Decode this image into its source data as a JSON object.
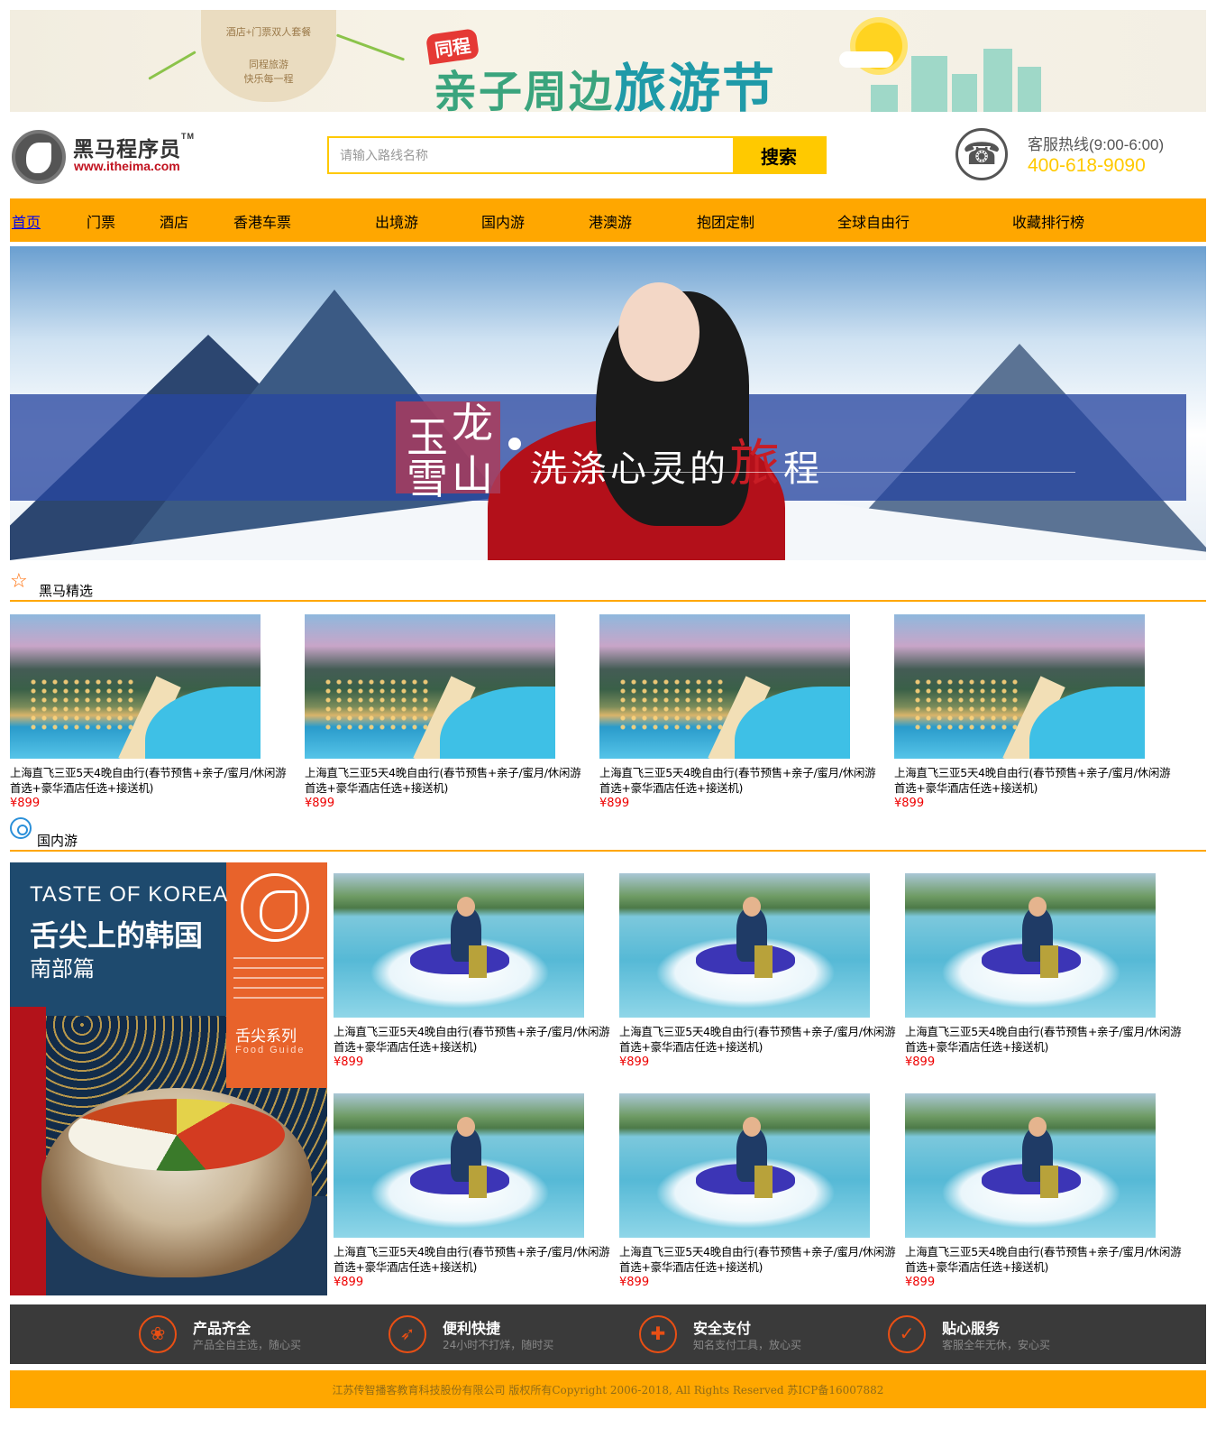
{
  "top_banner": {
    "badge_lines": [
      "酒店+门票双人套餐",
      "同程旅游",
      "快乐每一程"
    ],
    "tag": "同程",
    "title_part1": "亲子周边",
    "title_part2": "旅游节"
  },
  "header": {
    "logo_name": "黑马程序员",
    "logo_tm": "TM",
    "logo_url": "www.itheima.com",
    "search_placeholder": "请输入路线名称",
    "search_button": "搜索",
    "hotline_label": "客服热线(9:00-6:00)",
    "hotline_number": "400-618-9090"
  },
  "nav": {
    "items": [
      "首页",
      "门票",
      "酒店",
      "香港车票",
      "出境游",
      "国内游",
      "港澳游",
      "抱团定制",
      "全球自由行",
      "收藏排行榜"
    ]
  },
  "hero": {
    "box_chars": [
      "玉",
      "龙",
      "雪",
      "山"
    ],
    "slogan_part1": "洗涤心灵的",
    "slogan_red": "旅",
    "slogan_part2": "程"
  },
  "section_featured": {
    "title": "黑马精选",
    "cards": [
      {
        "desc": "上海直飞三亚5天4晚自由行(春节预售+亲子/蜜月/休闲游首选+豪华酒店任选+接送机)",
        "price": "¥899"
      },
      {
        "desc": "上海直飞三亚5天4晚自由行(春节预售+亲子/蜜月/休闲游首选+豪华酒店任选+接送机)",
        "price": "¥899"
      },
      {
        "desc": "上海直飞三亚5天4晚自由行(春节预售+亲子/蜜月/休闲游首选+豪华酒店任选+接送机)",
        "price": "¥899"
      },
      {
        "desc": "上海直飞三亚5天4晚自由行(春节预售+亲子/蜜月/休闲游首选+豪华酒店任选+接送机)",
        "price": "¥899"
      }
    ]
  },
  "section_domestic": {
    "title": "国内游",
    "poster": {
      "line1": "TASTE OF KOREA",
      "line2": "舌尖上的韩国",
      "line3": "南部篇",
      "series": "舌尖系列",
      "series_en": "Food Guide"
    },
    "cards": [
      {
        "desc": "上海直飞三亚5天4晚自由行(春节预售+亲子/蜜月/休闲游首选+豪华酒店任选+接送机)",
        "price": "¥899"
      },
      {
        "desc": "上海直飞三亚5天4晚自由行(春节预售+亲子/蜜月/休闲游首选+豪华酒店任选+接送机)",
        "price": "¥899"
      },
      {
        "desc": "上海直飞三亚5天4晚自由行(春节预售+亲子/蜜月/休闲游首选+豪华酒店任选+接送机)",
        "price": "¥899"
      },
      {
        "desc": "上海直飞三亚5天4晚自由行(春节预售+亲子/蜜月/休闲游首选+豪华酒店任选+接送机)",
        "price": "¥899"
      },
      {
        "desc": "上海直飞三亚5天4晚自由行(春节预售+亲子/蜜月/休闲游首选+豪华酒店任选+接送机)",
        "price": "¥899"
      },
      {
        "desc": "上海直飞三亚5天4晚自由行(春节预售+亲子/蜜月/休闲游首选+豪华酒店任选+接送机)",
        "price": "¥899"
      }
    ]
  },
  "features": [
    {
      "icon": "grid-icon",
      "title": "产品齐全",
      "sub": "产品全自主选，随心买"
    },
    {
      "icon": "rocket-icon",
      "title": "便利快捷",
      "sub": "24小时不打烊，随时买"
    },
    {
      "icon": "shield-icon",
      "title": "安全支付",
      "sub": "知名支付工具，放心买"
    },
    {
      "icon": "thumbs-up-icon",
      "title": "贴心服务",
      "sub": "客服全年无休，安心买"
    }
  ],
  "footer": {
    "copyright": "江苏传智播客教育科技股份有限公司 版权所有Copyright 2006-2018, All Rights Reserved 苏ICP备16007882"
  },
  "colors": {
    "nav_bg": "#ffa700",
    "search_accent": "#ffc900",
    "price": "#ee0000",
    "feature_bar": "#3a3a3a"
  }
}
